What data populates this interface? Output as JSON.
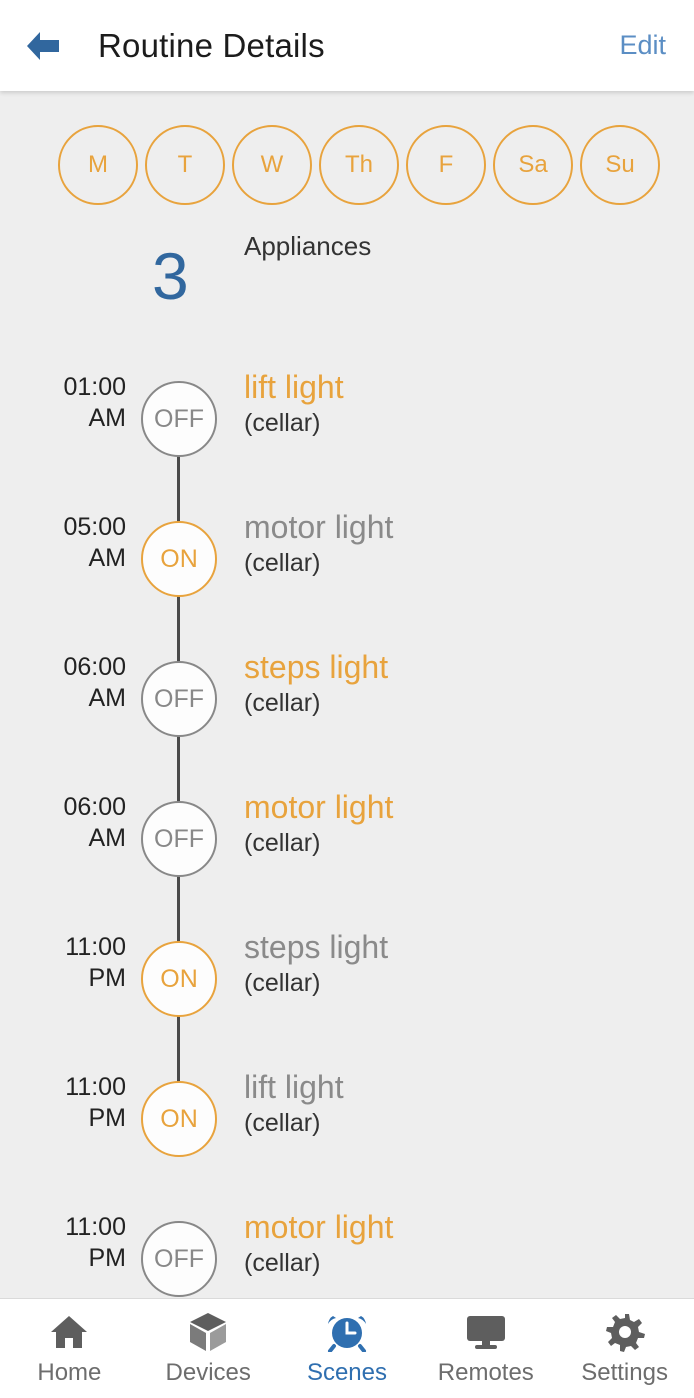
{
  "header": {
    "back_icon": "arrow-left-icon",
    "title": "Routine Details",
    "edit_label": "Edit",
    "accent_blue": "#31679e",
    "link_blue": "#5b8ec4"
  },
  "days": [
    {
      "label": "M"
    },
    {
      "label": "T"
    },
    {
      "label": "W"
    },
    {
      "label": "Th"
    },
    {
      "label": "F"
    },
    {
      "label": "Sa"
    },
    {
      "label": "Su"
    }
  ],
  "summary": {
    "count": "3",
    "label": "Appliances"
  },
  "timeline": [
    {
      "time_line1": "01:00",
      "time_line2": "AM",
      "state": "OFF",
      "device": "lift light",
      "location": "(cellar)",
      "name_highlighted": true,
      "has_connector": true
    },
    {
      "time_line1": "05:00",
      "time_line2": "AM",
      "state": "ON",
      "device": "motor light",
      "location": "(cellar)",
      "name_highlighted": false,
      "has_connector": true
    },
    {
      "time_line1": "06:00",
      "time_line2": "AM",
      "state": "OFF",
      "device": "steps light",
      "location": "(cellar)",
      "name_highlighted": true,
      "has_connector": true
    },
    {
      "time_line1": "06:00",
      "time_line2": "AM",
      "state": "OFF",
      "device": "motor light",
      "location": "(cellar)",
      "name_highlighted": true,
      "has_connector": true
    },
    {
      "time_line1": "11:00",
      "time_line2": "PM",
      "state": "ON",
      "device": "steps light",
      "location": "(cellar)",
      "name_highlighted": false,
      "has_connector": true
    },
    {
      "time_line1": "11:00",
      "time_line2": "PM",
      "state": "ON",
      "device": "lift light",
      "location": "(cellar)",
      "name_highlighted": false,
      "has_connector": false
    },
    {
      "time_line1": "11:00",
      "time_line2": "PM",
      "state": "OFF",
      "device": "motor light",
      "location": "(cellar)",
      "name_highlighted": true,
      "has_connector": false
    }
  ],
  "colors": {
    "orange": "#e8a33d",
    "gray": "#888888",
    "background": "#eeeeee"
  },
  "bottom_nav": {
    "items": [
      {
        "label": "Home",
        "icon": "home-icon",
        "active": false
      },
      {
        "label": "Devices",
        "icon": "cube-icon",
        "active": false
      },
      {
        "label": "Scenes",
        "icon": "alarm-clock-icon",
        "active": true
      },
      {
        "label": "Remotes",
        "icon": "monitor-icon",
        "active": false
      },
      {
        "label": "Settings",
        "icon": "gear-icon",
        "active": false
      }
    ]
  }
}
